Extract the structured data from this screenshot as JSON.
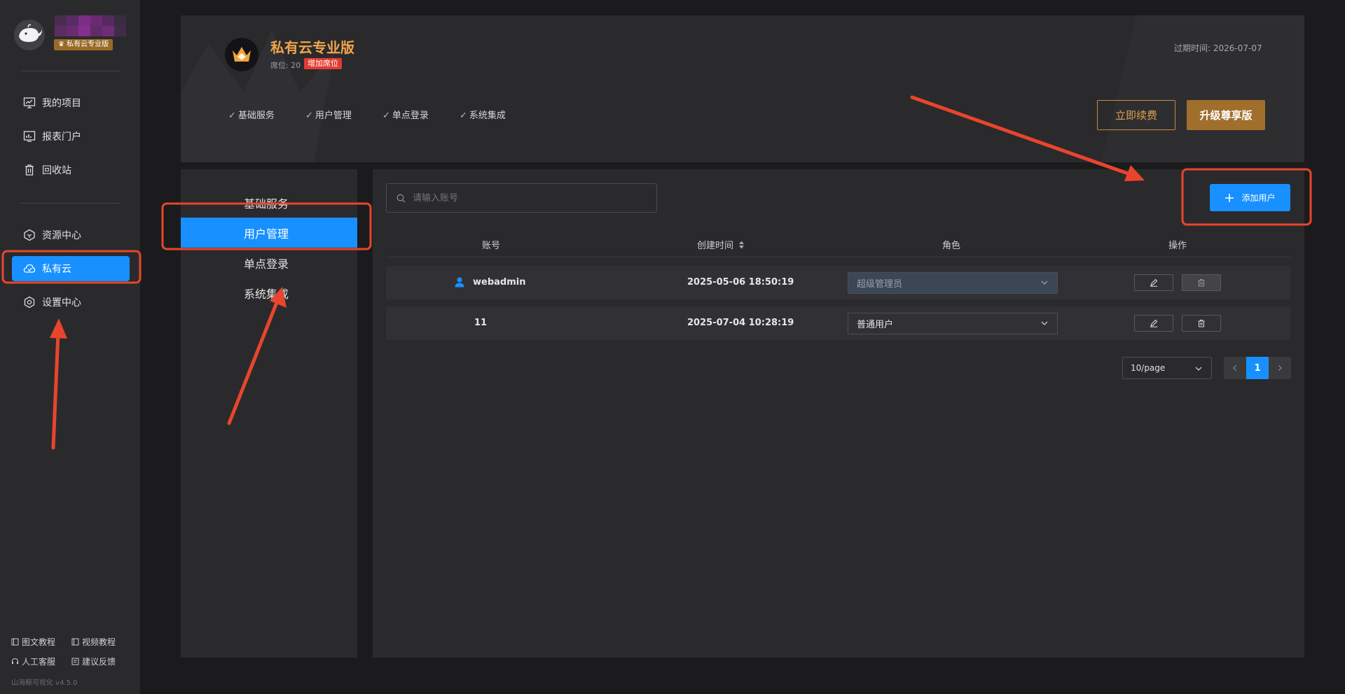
{
  "sidebar": {
    "plan_badge": "♛ 私有云专业版",
    "nav": [
      {
        "label": "我的项目",
        "icon": "monitor-chart-icon"
      },
      {
        "label": "报表门户",
        "icon": "report-icon"
      },
      {
        "label": "回收站",
        "icon": "trash-icon"
      },
      {
        "label": "资源中心",
        "icon": "cube-icon"
      },
      {
        "label": "私有云",
        "icon": "cloud-icon",
        "active": true
      },
      {
        "label": "设置中心",
        "icon": "gear-icon"
      }
    ],
    "footer": {
      "text_tutorial": "图文教程",
      "video_tutorial": "视频教程",
      "human_support": "人工客服",
      "feedback": "建议反馈",
      "version": "山海鲸可视化 v4.5.0"
    }
  },
  "header": {
    "title": "私有云专业版",
    "seats": "席位: 20",
    "add_seats": "增加席位",
    "expire": "过期时间:  2026-07-07",
    "features": [
      "基础服务",
      "用户管理",
      "单点登录",
      "系统集成"
    ],
    "renew_label": "立即续费",
    "upgrade_label": "升级尊享版"
  },
  "submenu": {
    "items": [
      "基础服务",
      "用户管理",
      "单点登录",
      "系统集成"
    ],
    "active": 1
  },
  "content": {
    "search_placeholder": "请输入账号",
    "add_user_label": "添加用户",
    "columns": {
      "account": "账号",
      "created": "创建时间",
      "role": "角色",
      "actions": "操作"
    },
    "rows": [
      {
        "account": "webadmin",
        "created": "2025-05-06 18:50:19",
        "role": "超级管理员"
      },
      {
        "account": "11",
        "created": "2025-07-04 10:28:19",
        "role": "普通用户"
      }
    ],
    "page_size": "10/page",
    "current_page": "1"
  },
  "colors": {
    "accent": "#1890ff",
    "gold": "#f0a54a",
    "annotation_red": "#e8452c"
  }
}
